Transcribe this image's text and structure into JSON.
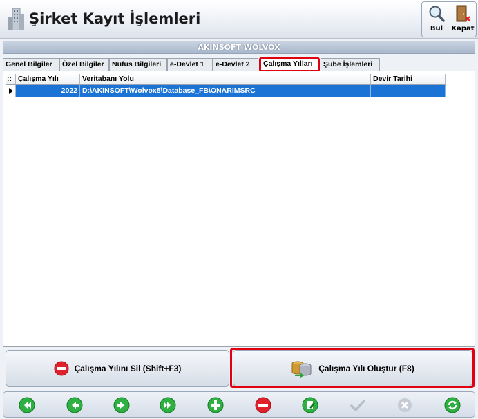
{
  "window": {
    "title": "Şirket Kayıt İşlemleri"
  },
  "toolbar": {
    "find_label": "Bul",
    "close_label": "Kapat"
  },
  "company": {
    "name": "AKINSOFT WOLVOX"
  },
  "tabs": [
    {
      "label": "Genel Bilgiler",
      "active": false
    },
    {
      "label": "Özel Bilgiler",
      "active": false
    },
    {
      "label": "Nüfus Bilgileri",
      "active": false
    },
    {
      "label": "e-Devlet 1",
      "active": false
    },
    {
      "label": "e-Devlet 2",
      "active": false
    },
    {
      "label": "Çalışma Yılları",
      "active": true
    },
    {
      "label": "Şube İşlemleri",
      "active": false
    }
  ],
  "grid": {
    "indicator_header": "::",
    "columns": [
      "Çalışma Yılı",
      "Veritabanı Yolu",
      "Devir Tarihi"
    ],
    "rows": [
      {
        "year": "2022",
        "path": "D:\\AKINSOFT\\Wolvox8\\Database_FB\\ONARIMSRC",
        "transfer_date": ""
      }
    ]
  },
  "actions": {
    "delete_label": "Çalışma Yılını Sil (Shift+F3)",
    "create_label": "Çalışma Yılı Oluştur (F8)"
  },
  "nav": {
    "buttons": [
      "first-icon",
      "prev-icon",
      "next-icon",
      "last-icon",
      "add-icon",
      "delete-icon",
      "edit-icon",
      "confirm-icon",
      "cancel-icon",
      "refresh-icon"
    ]
  },
  "colors": {
    "selection": "#1c73d6",
    "highlight": "#e00010"
  }
}
